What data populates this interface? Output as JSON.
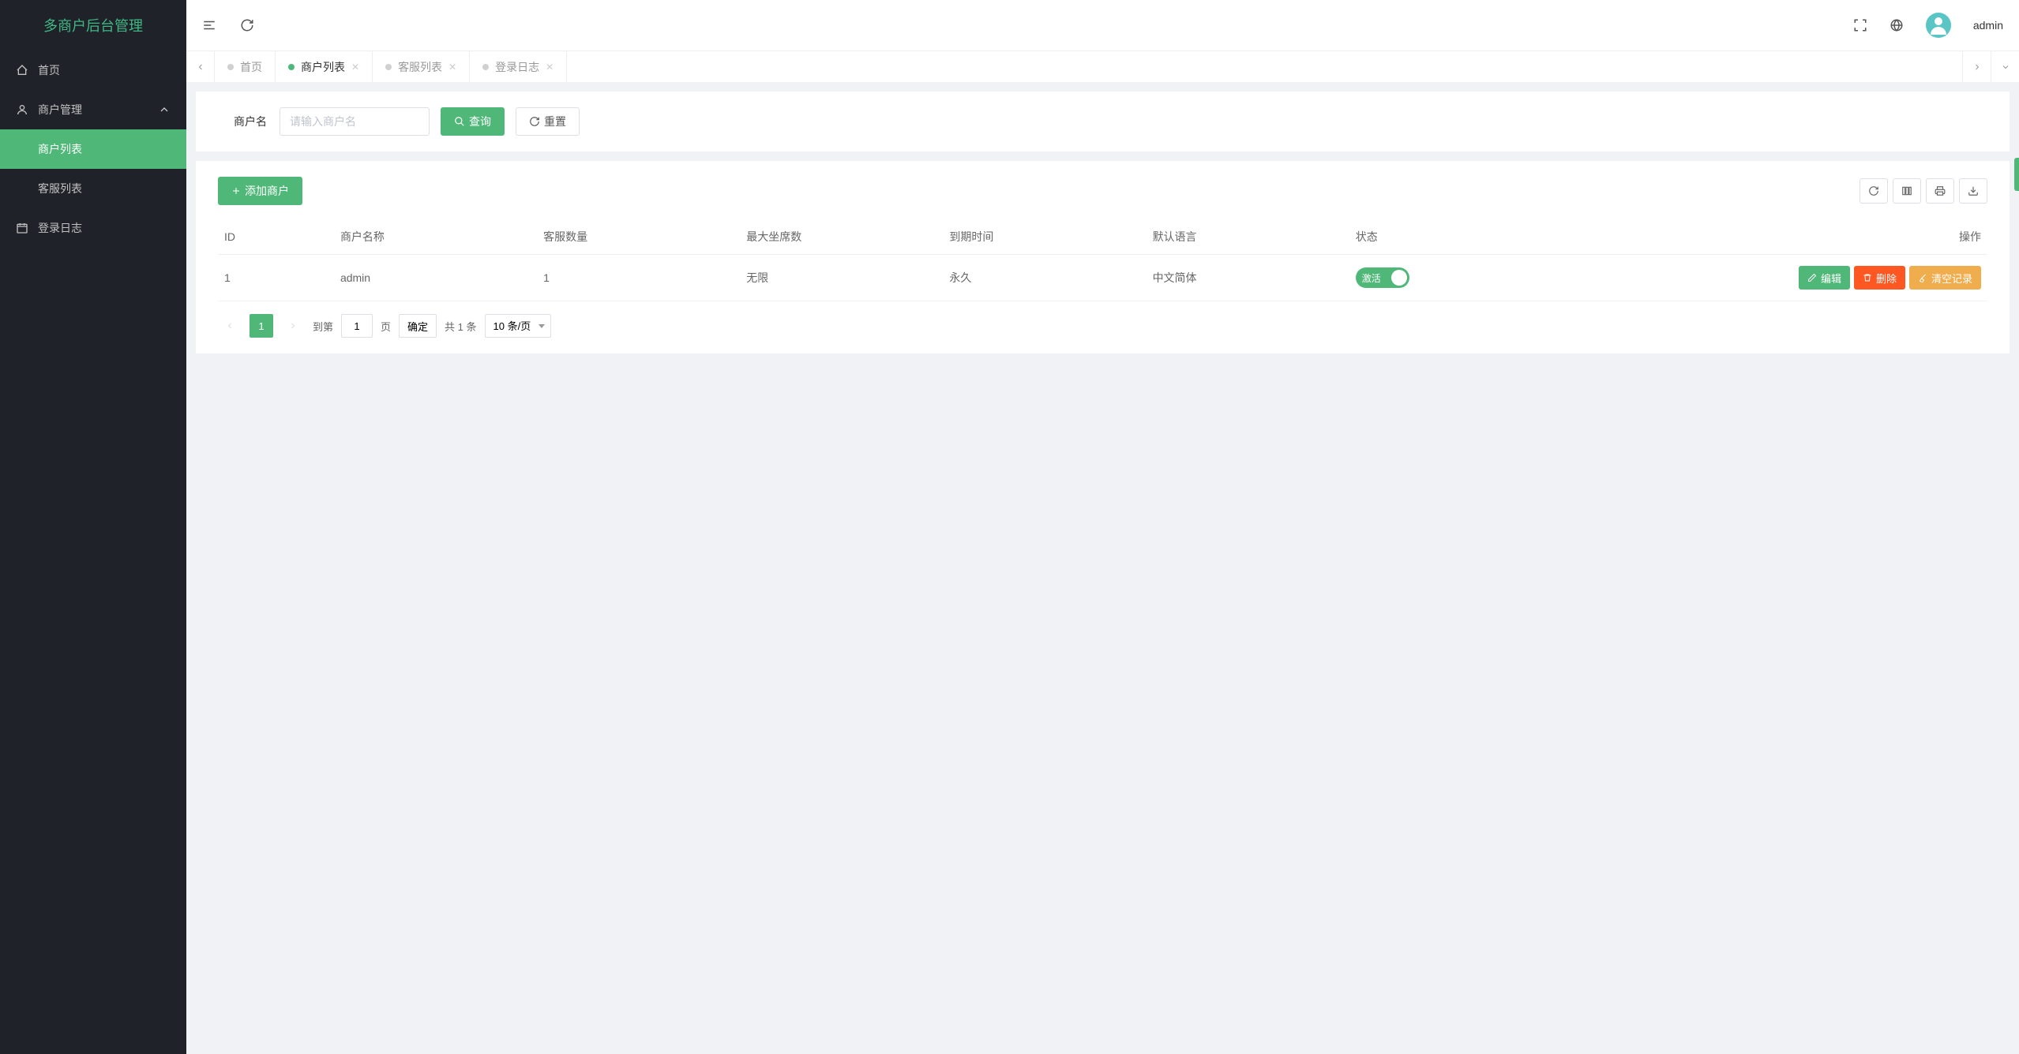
{
  "app": {
    "title": "多商户后台管理"
  },
  "header": {
    "username": "admin"
  },
  "sidebar": {
    "items": [
      {
        "label": "首页"
      },
      {
        "label": "商户管理",
        "children": [
          {
            "label": "商户列表",
            "active": true
          },
          {
            "label": "客服列表"
          }
        ]
      },
      {
        "label": "登录日志"
      }
    ]
  },
  "tabs": [
    {
      "label": "首页",
      "closable": false
    },
    {
      "label": "商户列表",
      "active": true,
      "closable": true
    },
    {
      "label": "客服列表",
      "closable": true
    },
    {
      "label": "登录日志",
      "closable": true
    }
  ],
  "search": {
    "label": "商户名",
    "placeholder": "请输入商户名",
    "query_btn": "查询",
    "reset_btn": "重置"
  },
  "table": {
    "add_btn": "添加商户",
    "headers": [
      "ID",
      "商户名称",
      "客服数量",
      "最大坐席数",
      "到期时间",
      "默认语言",
      "状态",
      "操作"
    ],
    "rows": [
      {
        "id": "1",
        "name": "admin",
        "service_count": "1",
        "max_seats": "无限",
        "expire": "永久",
        "lang": "中文简体",
        "status": "激活"
      }
    ],
    "row_actions": {
      "edit": "编辑",
      "delete": "删除",
      "clear": "清空记录"
    }
  },
  "pagination": {
    "current": "1",
    "goto_label": "到第",
    "page_label": "页",
    "goto_value": "1",
    "confirm": "确定",
    "total": "共 1 条",
    "page_size": "10 条/页"
  }
}
